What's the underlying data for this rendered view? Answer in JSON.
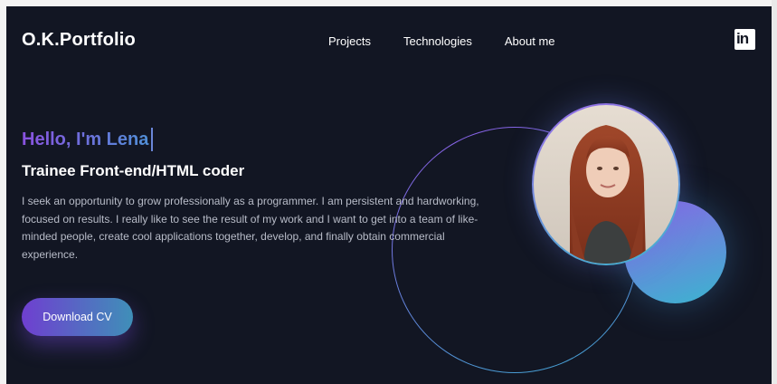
{
  "header": {
    "logo": "O.K.Portfolio",
    "nav": [
      {
        "label": "Projects"
      },
      {
        "label": "Technologies"
      },
      {
        "label": "About me"
      }
    ],
    "social_icon": "linkedin-icon",
    "social_text": "in"
  },
  "hero": {
    "greeting": "Hello, I'm Lena",
    "role": "Trainee Front-end/HTML coder",
    "bio": "I seek an opportunity to grow professionally as a programmer. I am persistent and hardworking, focused on results. I really like to see the result of my work and I want to get into a team of like-minded people, create cool applications together, develop, and finally obtain commercial experience.",
    "cta_label": "Download CV",
    "photo": "profile-photo"
  },
  "colors": {
    "background": "#121623",
    "accent_purple": "#8a52e0",
    "accent_blue": "#3fa6d2",
    "text": "#ffffff",
    "muted_text": "#b8bcc8"
  }
}
